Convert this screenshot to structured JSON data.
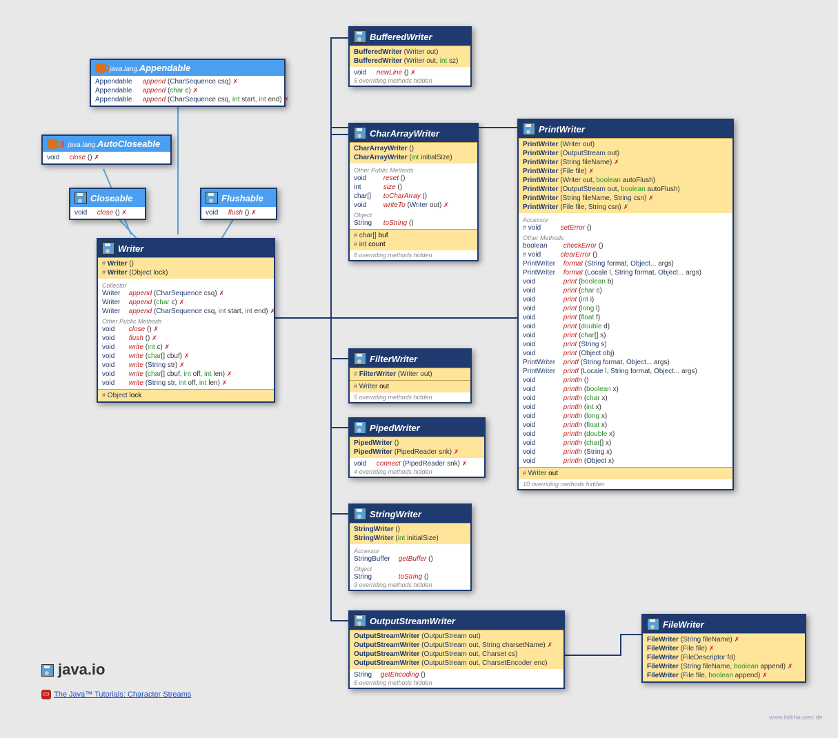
{
  "colors": {
    "header": "#1e3a6e",
    "interface": "#4a9ff0",
    "band": "#ffe599"
  },
  "appendable": {
    "pkg": "java.lang.",
    "title": "Appendable",
    "m": [
      {
        "ret": "Appendable",
        "name": "append",
        "args": "(CharSequence csq)",
        "t": 1
      },
      {
        "ret": "Appendable",
        "name": "append",
        "args": "(char c)",
        "t": 1
      },
      {
        "ret": "Appendable",
        "name": "append",
        "args": "(CharSequence csq, int start, int end)",
        "t": 1
      }
    ]
  },
  "autocloseable": {
    "pkg": "java.lang.",
    "title": "AutoCloseable",
    "m": [
      {
        "ret": "void",
        "name": "close",
        "args": "()",
        "t": 1
      }
    ]
  },
  "closeable": {
    "title": "Closeable",
    "m": [
      {
        "ret": "void",
        "name": "close",
        "args": "()",
        "t": 1
      }
    ]
  },
  "flushable": {
    "title": "Flushable",
    "m": [
      {
        "ret": "void",
        "name": "flush",
        "args": "()",
        "t": 1
      }
    ]
  },
  "writer": {
    "title": "Writer",
    "ctors": [
      {
        "name": "Writer",
        "args": "()",
        "proto": "#"
      },
      {
        "name": "Writer",
        "args": "(Object lock)",
        "proto": "#"
      }
    ],
    "sec1": "Collector",
    "m1": [
      {
        "ret": "Writer",
        "name": "append",
        "args": "(CharSequence csq)",
        "t": 1
      },
      {
        "ret": "Writer",
        "name": "append",
        "args": "(char c)",
        "t": 1
      },
      {
        "ret": "Writer",
        "name": "append",
        "args": "(CharSequence csq, int start, int end)",
        "t": 1
      }
    ],
    "sec2": "Other Public Methods",
    "m2": [
      {
        "ret": "void",
        "name": "close",
        "args": "()",
        "t": 1
      },
      {
        "ret": "void",
        "name": "flush",
        "args": "()",
        "t": 1
      },
      {
        "ret": "void",
        "name": "write",
        "args": "(int c)",
        "t": 1
      },
      {
        "ret": "void",
        "name": "write",
        "args": "(char[] cbuf)",
        "t": 1
      },
      {
        "ret": "void",
        "name": "write",
        "args": "(String str)",
        "t": 1
      },
      {
        "ret": "void",
        "name": "write",
        "args": "(char[] cbuf, int off, int len)",
        "t": 1
      },
      {
        "ret": "void",
        "name": "write",
        "args": "(String str, int off, int len)",
        "t": 1
      }
    ],
    "field": {
      "proto": "#",
      "type": "Object",
      "name": "lock"
    }
  },
  "bufferedwriter": {
    "title": "BufferedWriter",
    "ctors": [
      {
        "name": "BufferedWriter",
        "args": "(Writer out)"
      },
      {
        "name": "BufferedWriter",
        "args": "(Writer out, int sz)"
      }
    ],
    "m": [
      {
        "ret": "void",
        "name": "newLine",
        "args": "()",
        "t": 1
      }
    ],
    "hidden": "5 overriding methods hidden"
  },
  "chararraywriter": {
    "title": "CharArrayWriter",
    "ctors": [
      {
        "name": "CharArrayWriter",
        "args": "()"
      },
      {
        "name": "CharArrayWriter",
        "args": "(int initialSize)"
      }
    ],
    "sec1": "Other Public Methods",
    "m1": [
      {
        "ret": "void",
        "name": "reset",
        "args": "()"
      },
      {
        "ret": "int",
        "name": "size",
        "args": "()"
      },
      {
        "ret": "char[]",
        "name": "toCharArray",
        "args": "()"
      },
      {
        "ret": "void",
        "name": "writeTo",
        "args": "(Writer out)",
        "t": 1
      }
    ],
    "sec2": "Object",
    "m2": [
      {
        "ret": "String",
        "name": "toString",
        "args": "()"
      }
    ],
    "fields": [
      {
        "proto": "#",
        "type": "char[]",
        "name": "buf"
      },
      {
        "proto": "#",
        "type": "int",
        "name": "count"
      }
    ],
    "hidden": "8 overriding methods hidden"
  },
  "filterwriter": {
    "title": "FilterWriter",
    "ctors": [
      {
        "name": "FilterWriter",
        "args": "(Writer out)",
        "proto": "#"
      }
    ],
    "field": {
      "proto": "#",
      "type": "Writer",
      "name": "out"
    },
    "hidden": "5 overriding methods hidden"
  },
  "pipedwriter": {
    "title": "PipedWriter",
    "ctors": [
      {
        "name": "PipedWriter",
        "args": "()"
      },
      {
        "name": "PipedWriter",
        "args": "(PipedReader snk)",
        "t": 1
      }
    ],
    "m": [
      {
        "ret": "void",
        "name": "connect",
        "args": "(PipedReader snk)",
        "t": 1
      }
    ],
    "hidden": "4 overriding methods hidden"
  },
  "stringwriter": {
    "title": "StringWriter",
    "ctors": [
      {
        "name": "StringWriter",
        "args": "()"
      },
      {
        "name": "StringWriter",
        "args": "(int initialSize)"
      }
    ],
    "sec1": "Accessor",
    "m1": [
      {
        "ret": "StringBuffer",
        "name": "getBuffer",
        "args": "()"
      }
    ],
    "sec2": "Object",
    "m2": [
      {
        "ret": "String",
        "name": "toString",
        "args": "()"
      }
    ],
    "hidden": "9 overriding methods hidden"
  },
  "outputstreamwriter": {
    "title": "OutputStreamWriter",
    "ctors": [
      {
        "name": "OutputStreamWriter",
        "args": "(OutputStream out)"
      },
      {
        "name": "OutputStreamWriter",
        "args": "(OutputStream out, String charsetName)",
        "t": 1
      },
      {
        "name": "OutputStreamWriter",
        "args": "(OutputStream out, Charset cs)"
      },
      {
        "name": "OutputStreamWriter",
        "args": "(OutputStream out, CharsetEncoder enc)"
      }
    ],
    "m": [
      {
        "ret": "String",
        "name": "getEncoding",
        "args": "()"
      }
    ],
    "hidden": "5 overriding methods hidden"
  },
  "filewriter": {
    "title": "FileWriter",
    "ctors": [
      {
        "name": "FileWriter",
        "args": "(String fileName)",
        "t": 1
      },
      {
        "name": "FileWriter",
        "args": "(File file)",
        "t": 1
      },
      {
        "name": "FileWriter",
        "args": "(FileDescriptor fd)"
      },
      {
        "name": "FileWriter",
        "args": "(String fileName, boolean append)",
        "t": 1
      },
      {
        "name": "FileWriter",
        "args": "(File file, boolean append)",
        "t": 1
      }
    ]
  },
  "printwriter": {
    "title": "PrintWriter",
    "ctors": [
      {
        "name": "PrintWriter",
        "args": "(Writer out)"
      },
      {
        "name": "PrintWriter",
        "args": "(OutputStream out)"
      },
      {
        "name": "PrintWriter",
        "args": "(String fileName)",
        "t": 1
      },
      {
        "name": "PrintWriter",
        "args": "(File file)",
        "t": 1
      },
      {
        "name": "PrintWriter",
        "args": "(Writer out, boolean autoFlush)"
      },
      {
        "name": "PrintWriter",
        "args": "(OutputStream out, boolean autoFlush)"
      },
      {
        "name": "PrintWriter",
        "args": "(String fileName, String csn)",
        "t": 1
      },
      {
        "name": "PrintWriter",
        "args": "(File file, String csn)",
        "t": 1
      }
    ],
    "sec1": "Accessor",
    "m1": [
      {
        "proto": "#",
        "ret": "void",
        "name": "setError",
        "args": "()"
      }
    ],
    "sec2": "Other Methods",
    "m2": [
      {
        "ret": "boolean",
        "name": "checkError",
        "args": "()"
      },
      {
        "proto": "#",
        "ret": "void",
        "name": "clearError",
        "args": "()"
      },
      {
        "ret": "PrintWriter",
        "name": "format",
        "args": "(String format, Object... args)"
      },
      {
        "ret": "PrintWriter",
        "name": "format",
        "args": "(Locale l, String format, Object... args)"
      },
      {
        "ret": "void",
        "name": "print",
        "args": "(boolean b)"
      },
      {
        "ret": "void",
        "name": "print",
        "args": "(char c)"
      },
      {
        "ret": "void",
        "name": "print",
        "args": "(int i)"
      },
      {
        "ret": "void",
        "name": "print",
        "args": "(long l)"
      },
      {
        "ret": "void",
        "name": "print",
        "args": "(float f)"
      },
      {
        "ret": "void",
        "name": "print",
        "args": "(double d)"
      },
      {
        "ret": "void",
        "name": "print",
        "args": "(char[] s)"
      },
      {
        "ret": "void",
        "name": "print",
        "args": "(String s)"
      },
      {
        "ret": "void",
        "name": "print",
        "args": "(Object obj)"
      },
      {
        "ret": "PrintWriter",
        "name": "printf",
        "args": "(String format, Object... args)"
      },
      {
        "ret": "PrintWriter",
        "name": "printf",
        "args": "(Locale l, String format, Object... args)"
      },
      {
        "ret": "void",
        "name": "println",
        "args": "()"
      },
      {
        "ret": "void",
        "name": "println",
        "args": "(boolean x)"
      },
      {
        "ret": "void",
        "name": "println",
        "args": "(char x)"
      },
      {
        "ret": "void",
        "name": "println",
        "args": "(int x)"
      },
      {
        "ret": "void",
        "name": "println",
        "args": "(long x)"
      },
      {
        "ret": "void",
        "name": "println",
        "args": "(float x)"
      },
      {
        "ret": "void",
        "name": "println",
        "args": "(double x)"
      },
      {
        "ret": "void",
        "name": "println",
        "args": "(char[] x)"
      },
      {
        "ret": "void",
        "name": "println",
        "args": "(String x)"
      },
      {
        "ret": "void",
        "name": "println",
        "args": "(Object x)"
      }
    ],
    "field": {
      "proto": "#",
      "type": "Writer",
      "name": "out"
    },
    "hidden": "10 overriding methods hidden"
  },
  "pkgicon": "java.io",
  "tutorial": "The Java™ Tutorials: Character Streams",
  "copyright": "www.falkhausen.de"
}
